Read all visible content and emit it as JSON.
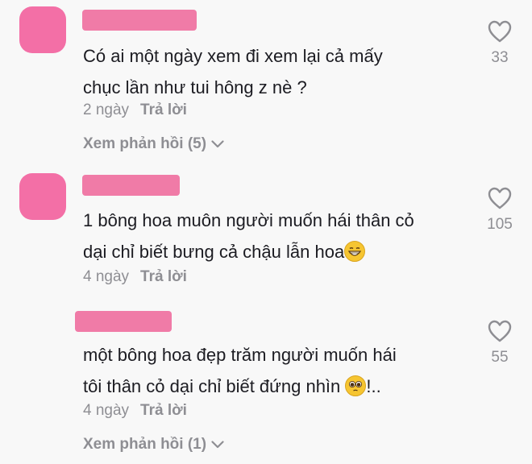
{
  "comments": [
    {
      "text_lines": [
        "Có ai một ngày xem đi xem lại cả mấy",
        "chục lần như tui hông z nè ?"
      ],
      "time": "2 ngày",
      "reply_label": "Trả lời",
      "like_count": "33",
      "view_replies": "Xem phản hồi (5)"
    },
    {
      "text_lines": [
        "1 bông hoa muôn người muốn hái thân cỏ",
        "dại chỉ biết bưng cả chậu lẫn hoa"
      ],
      "time": "4 ngày",
      "reply_label": "Trả lời",
      "like_count": "105",
      "emoji": "grinning-face-emoji"
    },
    {
      "text_lines": [
        "một bông hoa đẹp trăm người muốn hái",
        "tôi thân cỏ dại chỉ biết đứng nhìn"
      ],
      "text_suffix": "!..",
      "time": "4 ngày",
      "reply_label": "Trả lời",
      "like_count": "55",
      "view_replies": "Xem phản hồi (1)",
      "emoji": "pleading-face-emoji"
    }
  ],
  "icons": {
    "like": "heart-outline-icon",
    "expand": "chevron-down-icon"
  },
  "colors": {
    "avatar": "#f36fa6",
    "username_redacted": "#f07ba7",
    "muted": "#8e8e93"
  }
}
